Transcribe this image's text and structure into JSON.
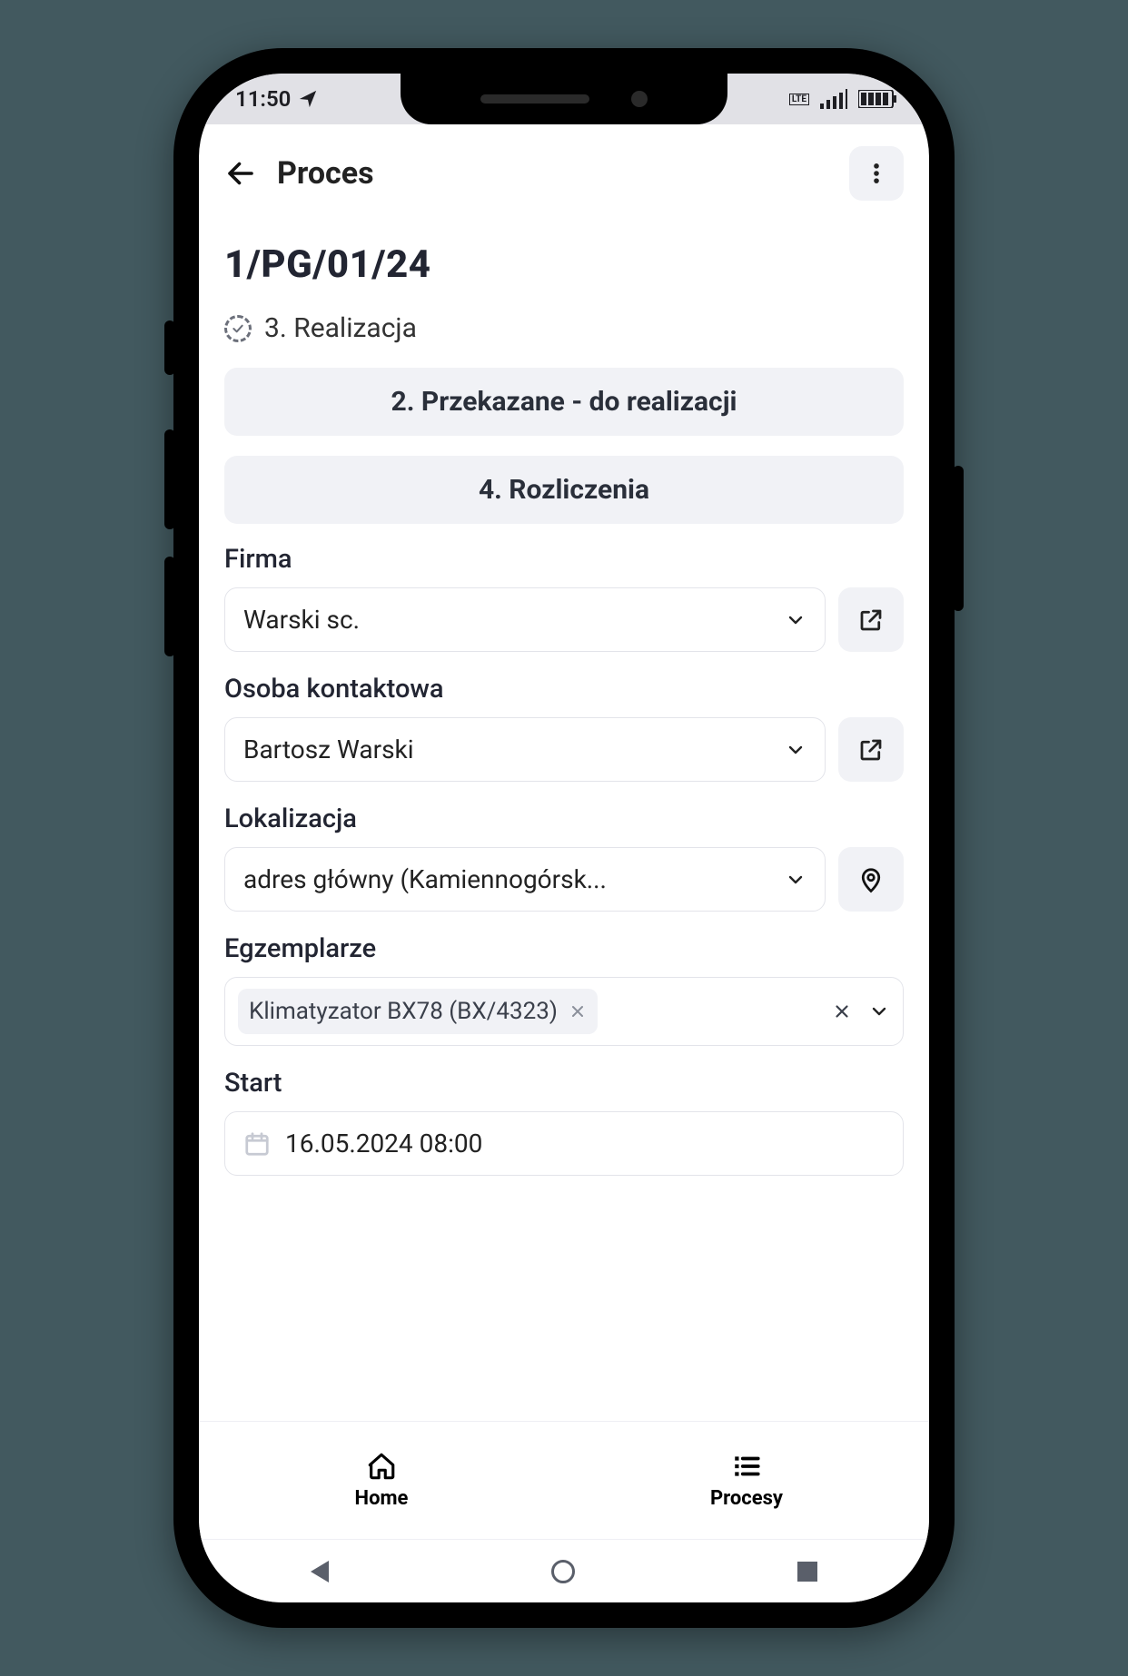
{
  "statusbar": {
    "time": "11:50",
    "network_label": "LTE"
  },
  "header": {
    "title": "Proces"
  },
  "page": {
    "id": "1/PG/01/24",
    "current_status": "3. Realizacja",
    "status_options": {
      "opt1": "2. Przekazane - do realizacji",
      "opt2": "4. Rozliczenia"
    }
  },
  "fields": {
    "company": {
      "label": "Firma",
      "value": "Warski sc."
    },
    "contact": {
      "label": "Osoba kontaktowa",
      "value": "Bartosz Warski"
    },
    "location": {
      "label": "Lokalizacja",
      "value": "adres główny (Kamiennogórsk..."
    },
    "items": {
      "label": "Egzemplarze",
      "chip": "Klimatyzator BX78 (BX/4323)"
    },
    "start": {
      "label": "Start",
      "value": "16.05.2024 08:00"
    }
  },
  "nav": {
    "home": "Home",
    "processes": "Procesy"
  }
}
